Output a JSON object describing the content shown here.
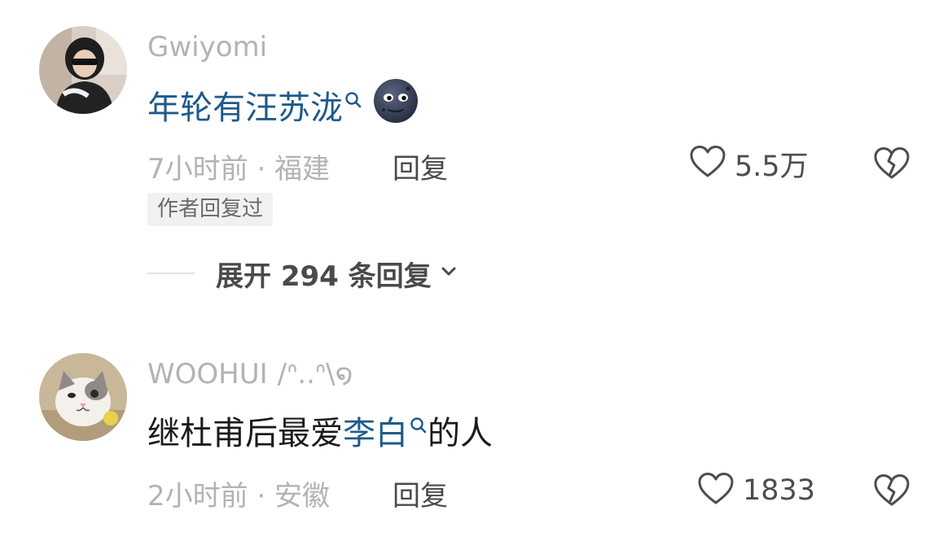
{
  "comments": [
    {
      "username": "Gwiyomi",
      "username_suffix": "",
      "avatar_icon": "avatar-photo-person-sunglasses",
      "text_prefix": "",
      "keyword": "年轮有汪苏泷",
      "text_suffix": "",
      "emoji": "new-moon-face-emoji",
      "time_location": "7小时前 · 福建",
      "reply_label": "回复",
      "likes": "5.5万",
      "author_badge": "作者回复过",
      "expand_label": "展开 294 条回复"
    },
    {
      "username": "WOOHUI",
      "username_suffix": "/ᐢ..ᐢ\\໑",
      "avatar_icon": "avatar-photo-cat",
      "text_prefix": "继杜甫后最爱",
      "keyword": "李白",
      "text_suffix": "的人",
      "time_location": "2小时前 · 安徽",
      "reply_label": "回复",
      "likes": "1833"
    }
  ],
  "colors": {
    "keyword_link": "#1f5a8a",
    "muted_text": "#b3b3b3",
    "primary_text": "#1b1b1b",
    "icon_gray": "#4d4d4d"
  }
}
